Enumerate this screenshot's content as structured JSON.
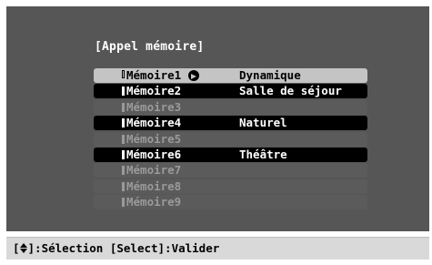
{
  "dialog": {
    "title": "[Appel mémoire]"
  },
  "memories": [
    {
      "name": "Mémoire1",
      "mode": "Dynamique",
      "state": "selected",
      "cursor_icon": "arrow-circle-icon"
    },
    {
      "name": "Mémoire2",
      "mode": "Salle de séjour",
      "state": "saved"
    },
    {
      "name": "Mémoire3",
      "mode": "",
      "state": "empty"
    },
    {
      "name": "Mémoire4",
      "mode": "Naturel",
      "state": "saved"
    },
    {
      "name": "Mémoire5",
      "mode": "",
      "state": "empty"
    },
    {
      "name": "Mémoire6",
      "mode": "Théâtre",
      "state": "saved"
    },
    {
      "name": "Mémoire7",
      "mode": "",
      "state": "empty"
    },
    {
      "name": "Mémoire8",
      "mode": "",
      "state": "empty"
    },
    {
      "name": "Mémoire9",
      "mode": "",
      "state": "empty"
    }
  ],
  "footer": {
    "open_bracket": "[",
    "nav_icon": "up-down-arrows-icon",
    "hint": "]:Sélection [Select]:Valider"
  },
  "colors": {
    "panel": "#565656",
    "selected_row": "#c4c4c4",
    "saved_row": "#000000",
    "empty_row": "#5b5b5b",
    "footer": "#d9d9d9"
  }
}
